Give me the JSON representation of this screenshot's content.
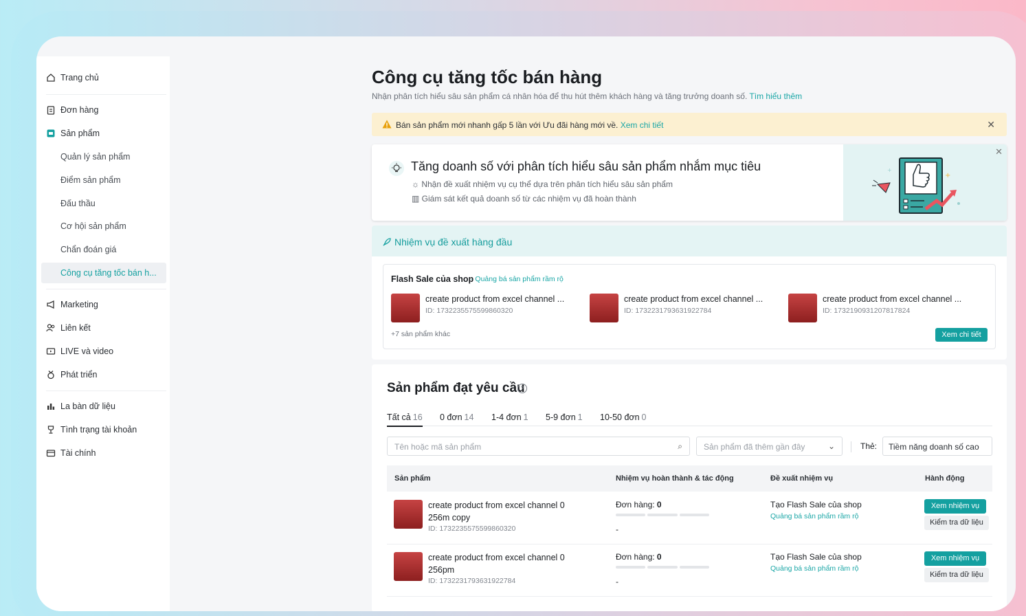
{
  "sidebar": {
    "items": [
      {
        "label": "Trang chủ",
        "icon": "home-icon"
      },
      {
        "label": "Đơn hàng",
        "icon": "clipboard-icon"
      },
      {
        "label": "Sản phẩm",
        "icon": "product-icon"
      },
      {
        "label": "Quản lý sản phẩm"
      },
      {
        "label": "Điểm sản phẩm"
      },
      {
        "label": "Đấu thầu"
      },
      {
        "label": "Cơ hội sản phẩm"
      },
      {
        "label": "Chẩn đoán giá"
      },
      {
        "label": "Công cụ tăng tốc bán h..."
      },
      {
        "label": "Marketing",
        "icon": "megaphone-icon"
      },
      {
        "label": "Liên kết",
        "icon": "users-icon"
      },
      {
        "label": "LIVE và video",
        "icon": "live-icon"
      },
      {
        "label": "Phát triển",
        "icon": "medal-icon"
      },
      {
        "label": "La bàn dữ liệu",
        "icon": "chart-icon"
      },
      {
        "label": "Tình trạng tài khoản",
        "icon": "trophy-icon"
      },
      {
        "label": "Tài chính",
        "icon": "wallet-icon"
      }
    ]
  },
  "page": {
    "title": "Công cụ tăng tốc bán hàng",
    "subtitle": "Nhận phân tích hiểu sâu sản phẩm cá nhân hóa để thu hút thêm khách hàng và tăng trưởng doanh số.",
    "learn_more": "Tìm hiểu thêm"
  },
  "notice": {
    "text": "Bán sản phẩm mới nhanh gấp 5 lần với Ưu đãi hàng mới về.",
    "link": "Xem chi tiết"
  },
  "promo": {
    "title": "Tăng doanh số với phân tích hiểu sâu sản phẩm nhắm mục tiêu",
    "line1": "Nhận đề xuất nhiệm vụ cụ thể dựa trên phân tích hiểu sâu sản phẩm",
    "line2": "Giám sát kết quả doanh số từ các nhiệm vụ đã hoàn thành"
  },
  "top_tasks": {
    "heading": "Nhiệm vụ đề xuất hàng đầu",
    "card_title": "Flash Sale của shop",
    "card_tag": "Quảng bá sản phẩm rầm rộ",
    "products": [
      {
        "name": "create product from excel channel ...",
        "id": "ID: 1732235575599860320"
      },
      {
        "name": "create product from excel channel ...",
        "id": "ID: 1732231793631922784"
      },
      {
        "name": "create product from excel channel ...",
        "id": "ID: 1732190931207817824"
      }
    ],
    "more": "+7 sản phẩm khác",
    "view_btn": "Xem chi tiết"
  },
  "qualified": {
    "title": "Sản phẩm đạt yêu cầu",
    "tabs": [
      {
        "label": "Tất cả",
        "count": "16"
      },
      {
        "label": "0 đơn",
        "count": "14"
      },
      {
        "label": "1-4 đơn",
        "count": "1"
      },
      {
        "label": "5-9 đơn",
        "count": "1"
      },
      {
        "label": "10-50 đơn",
        "count": "0"
      }
    ],
    "search_placeholder": "Tên hoặc mã sản phẩm",
    "select_placeholder": "Sản phẩm đã thêm gần đây",
    "tag_label": "Thẻ:",
    "tag_value": "Tiềm năng doanh số cao",
    "columns": [
      "Sản phẩm",
      "Nhiệm vụ hoàn thành & tác động",
      "Đề xuất nhiệm vụ",
      "Hành động"
    ],
    "rows": [
      {
        "name": "create product from excel channel 0 256m copy",
        "id": "ID: 1732235575599860320",
        "orders_label": "Đơn hàng:",
        "orders_value": "0",
        "dash": "-",
        "suggest": "Tạo Flash Sale của shop",
        "suggest_sub": "Quảng bá sản phẩm rầm rộ",
        "btn1": "Xem nhiệm vụ",
        "btn2": "Kiểm tra dữ liệu"
      },
      {
        "name": "create product from excel channel 0 256pm",
        "id": "ID: 1732231793631922784",
        "orders_label": "Đơn hàng:",
        "orders_value": "0",
        "dash": "-",
        "suggest": "Tạo Flash Sale của shop",
        "suggest_sub": "Quảng bá sản phẩm rầm rộ",
        "btn1": "Xem nhiệm vụ",
        "btn2": "Kiểm tra dữ liệu"
      }
    ]
  },
  "colors": {
    "accent": "#14a0a0",
    "notice_bg": "#fcf0d1",
    "thumb": "#b83535"
  }
}
